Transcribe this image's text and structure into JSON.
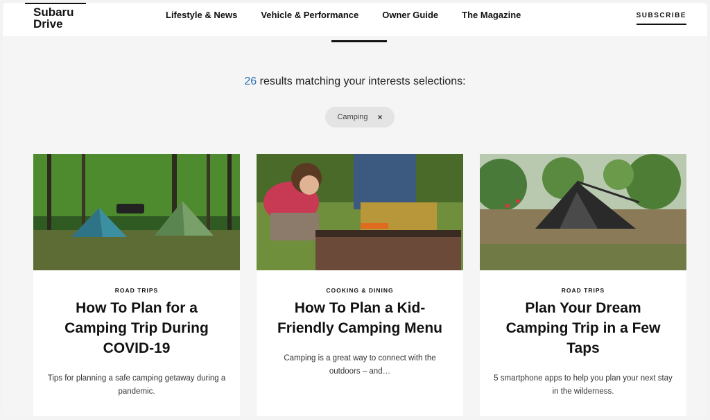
{
  "brand": {
    "line1": "Subaru",
    "line2": "Drive"
  },
  "nav": {
    "items": [
      "Lifestyle & News",
      "Vehicle & Performance",
      "Owner Guide",
      "The Magazine"
    ],
    "subscribe": "SUBSCRIBE"
  },
  "results": {
    "count": "26",
    "text": "results matching your interests selections:"
  },
  "filter": {
    "label": "Camping",
    "remove_icon": "×"
  },
  "cards": [
    {
      "category": "ROAD TRIPS",
      "title": "How To Plan for a Camping Trip During COVID-19",
      "excerpt": "Tips for planning a safe camping getaway during a pandemic.",
      "image": "tents-in-forest"
    },
    {
      "category": "COOKING & DINING",
      "title": "How To Plan a Kid-Friendly Camping Menu",
      "excerpt": "Camping is a great way to connect with the outdoors – and…",
      "image": "campfire-cooking"
    },
    {
      "category": "ROAD TRIPS",
      "title": "Plan Your Dream Camping Trip in a Few Taps",
      "excerpt": "5 smartphone apps to help you plan your next stay in the wilderness.",
      "image": "tent-in-orchard"
    }
  ],
  "colors": {
    "accent": "#2f6fb6",
    "text": "#111111",
    "background": "#f5f5f5"
  }
}
